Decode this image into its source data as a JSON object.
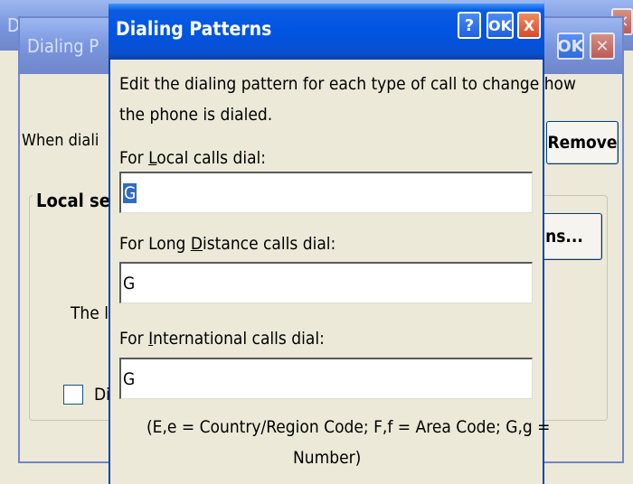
{
  "back_window": {
    "title": "Dia"
  },
  "mid_window": {
    "title": "Dialing P",
    "when_text": "When diali",
    "remove_button": "Remove",
    "group_title": "Local se",
    "options_button": "ns...",
    "partial_text": "The l",
    "checkbox_label": "Di"
  },
  "dialog": {
    "title": "Dialing Patterns",
    "help_button": "?",
    "ok_button": "OK",
    "close_button": "X",
    "instructions_line1": "Edit the dialing pattern for each type of call to change how",
    "instructions_line2": "the phone is dialed.",
    "local_label_pre": "For ",
    "local_label_key": "L",
    "local_label_post": "ocal calls dial:",
    "local_value": "G",
    "long_label_pre": "For Long ",
    "long_label_key": "D",
    "long_label_post": "istance calls dial:",
    "long_value": "G",
    "intl_label_pre": "For ",
    "intl_label_key": "I",
    "intl_label_post": "nternational calls dial:",
    "intl_value": "G",
    "legend_line1": "(E,e = Country/Region Code; F,f = Area Code; G,g =",
    "legend_line2": "Number)"
  }
}
